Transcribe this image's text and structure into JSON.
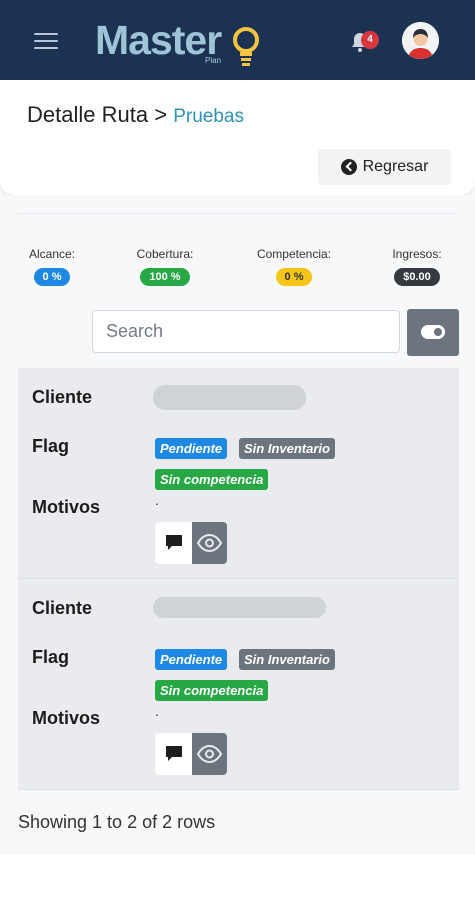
{
  "navbar": {
    "menu_icon": "hamburger-icon",
    "logo_text": "Master",
    "logo_sub": "Plan",
    "notification_count": "4",
    "colors": {
      "bar": "#1c3253",
      "logo": "#9fc4d6",
      "bulb": "#f5c542",
      "badge": "#d8383d"
    }
  },
  "header": {
    "title": "Detalle Ruta",
    "separator": ">",
    "breadcrumb": "Pruebas",
    "back_label": "Regresar",
    "back_icon": "chevron-left-circle-icon"
  },
  "stats": [
    {
      "label": "Alcance:",
      "value": "0 %",
      "color": "#1e88e5"
    },
    {
      "label": "Cobertura:",
      "value": "100 %",
      "color": "#28a745"
    },
    {
      "label": "Competencia:",
      "value": "0 %",
      "color": "#f5c518"
    },
    {
      "label": "Ingresos:",
      "value": "$0.00",
      "color": "#343a40"
    }
  ],
  "search": {
    "placeholder": "Search",
    "value": ""
  },
  "toggle_icon": "toggle-on-icon",
  "labels": {
    "cliente": "Cliente",
    "flag": "Flag",
    "motivos": "Motivos"
  },
  "rows": [
    {
      "cliente": "",
      "flags": [
        "Pendiente",
        "Sin Inventario",
        "Sin competencia"
      ],
      "motivos": "."
    },
    {
      "cliente": "",
      "flags": [
        "Pendiente",
        "Sin Inventario",
        "Sin competencia"
      ],
      "motivos": "."
    }
  ],
  "flag_colors": {
    "Pendiente": "#1e88e5",
    "Sin Inventario": "#6c757d",
    "Sin competencia": "#28a745"
  },
  "row_actions": {
    "comment_icon": "comment-icon",
    "view_icon": "eye-icon"
  },
  "footer": {
    "pagination_text": "Showing 1 to 2 of 2 rows"
  }
}
